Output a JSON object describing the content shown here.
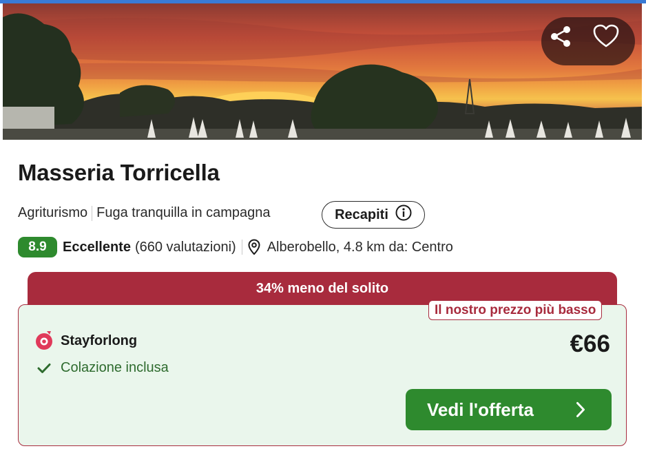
{
  "hotel": {
    "name": "Masseria Torricella",
    "type": "Agriturismo",
    "tagline": "Fuga tranquilla in campagna",
    "contacts_label": "Recapiti",
    "score": "8.9",
    "rating_label": "Eccellente",
    "reviews": "(660 valutazioni)",
    "location": "Alberobello, 4.8 km da: Centro"
  },
  "deal": {
    "discount_banner": "34% meno del solito",
    "lowest_badge": "Il nostro prezzo più basso",
    "provider": "Stayforlong",
    "price": "€66",
    "amenity": "Colazione inclusa",
    "cta_label": "Vedi l'offerta"
  },
  "icons": {
    "share": "share-icon",
    "favorite": "heart-icon",
    "info": "info-icon",
    "location": "map-pin-icon",
    "provider": "stayforlong-logo",
    "check": "check-icon",
    "chevron": "chevron-right-icon"
  },
  "colors": {
    "brand_red": "#a82b3d",
    "score_green": "#2e8a2e",
    "card_bg": "#eaf6ec",
    "amenity_green": "#2e6b2e"
  }
}
